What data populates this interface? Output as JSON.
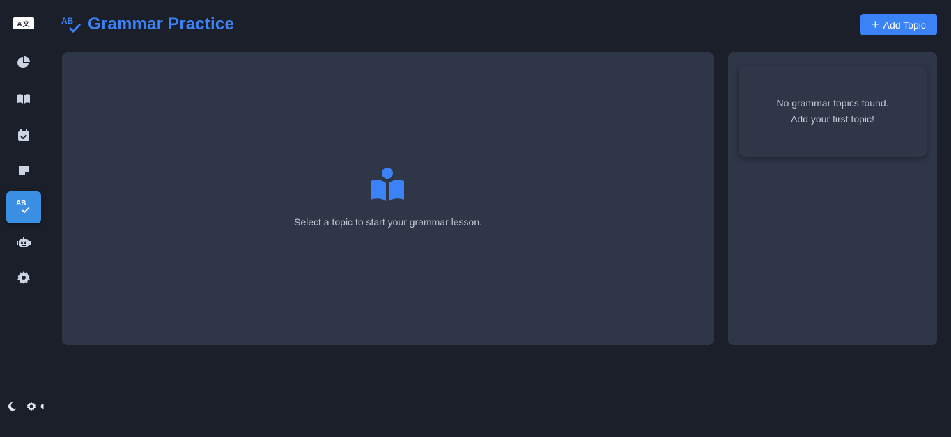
{
  "app": {
    "logo_text": "A文"
  },
  "sidebar": {
    "items": [
      {
        "name": "dashboard",
        "icon": "pie-chart-icon"
      },
      {
        "name": "vocabulary",
        "icon": "book-open-icon"
      },
      {
        "name": "schedule",
        "icon": "calendar-check-icon"
      },
      {
        "name": "notes",
        "icon": "sticky-note-icon"
      },
      {
        "name": "grammar",
        "icon": "spell-check-icon",
        "label": "AB",
        "active": true
      },
      {
        "name": "ai-assistant",
        "icon": "robot-icon"
      },
      {
        "name": "settings",
        "icon": "gear-icon"
      }
    ],
    "theme_controls": [
      "moon-icon",
      "sun-gear-icon",
      "half-moon-icon"
    ]
  },
  "header": {
    "title": "Grammar Practice",
    "icon_label": "AB",
    "add_button_label": "Add Topic"
  },
  "main": {
    "empty_message": "Select a topic to start your grammar lesson."
  },
  "topics": {
    "empty_line1": "No grammar topics found.",
    "empty_line2": "Add your first topic!"
  },
  "colors": {
    "background": "#1b1f2a",
    "panel": "#2e3647",
    "accent": "#3b82f6",
    "active_nav": "#3a8fe3"
  }
}
